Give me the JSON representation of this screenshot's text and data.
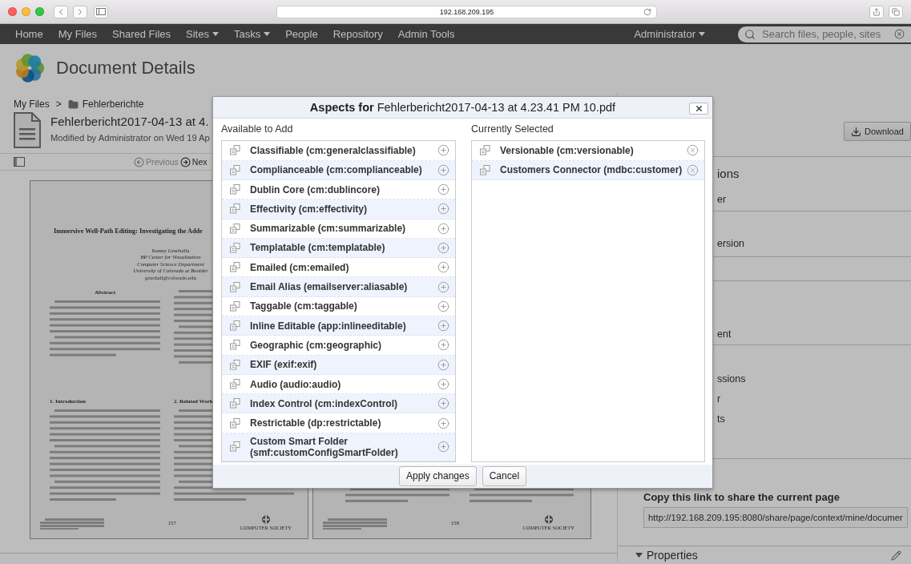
{
  "browser": {
    "address": "192.168.209.195"
  },
  "nav": {
    "items": [
      {
        "label": "Home",
        "dropdown": false
      },
      {
        "label": "My Files",
        "dropdown": false
      },
      {
        "label": "Shared Files",
        "dropdown": false
      },
      {
        "label": "Sites",
        "dropdown": true
      },
      {
        "label": "Tasks",
        "dropdown": true
      },
      {
        "label": "People",
        "dropdown": false
      },
      {
        "label": "Repository",
        "dropdown": false
      },
      {
        "label": "Admin Tools",
        "dropdown": false
      }
    ],
    "user": {
      "label": "Administrator",
      "dropdown": true
    },
    "search": {
      "placeholder": "Search files, people, sites"
    }
  },
  "header": {
    "title": "Document Details"
  },
  "breadcrumb": {
    "root": "My Files",
    "separator": ">",
    "folder": "Fehlerberichte"
  },
  "document": {
    "title": "Fehlerbericht2017-04-13 at 4.",
    "modified": "Modified by Administrator on Wed 19 Ap"
  },
  "viewer": {
    "previous": "Previous",
    "next": "Nex",
    "pages": [
      {
        "kind": "first",
        "title": "Immersive Well-Path Editing: Investigating the Adde",
        "authors": [
          {
            "text": "Kenny Gruchalla",
            "italic": false
          },
          {
            "text": "BP Center for Visualization",
            "italic": true
          },
          {
            "text": "Computer Science Department",
            "italic": true
          },
          {
            "text": "University of Colorado at Boulder",
            "italic": true
          },
          {
            "text": "gruchall@colorado.edu",
            "italic": false
          }
        ],
        "abstract_heading": "Abstract",
        "intro_heading": "1. Introduction",
        "related_heading": "2. Related Work",
        "page_number": "157",
        "logo_text": "COMPUTER SOCIETY"
      },
      {
        "kind": "continued",
        "page_number": "158",
        "logo_text": "COMPUTER SOCIETY"
      }
    ]
  },
  "side_panel": {
    "download": "Download",
    "sections": [
      {
        "heading": "ions",
        "items": [
          "er"
        ]
      },
      {
        "items": [
          "ersion"
        ]
      },
      {
        "items": [
          "ent"
        ]
      },
      {
        "items": [
          "ssions",
          "r",
          "ts"
        ]
      }
    ],
    "share": {
      "heading": "Copy this link to share the current page",
      "url": "http://192.168.209.195:8080/share/page/context/mine/documer"
    },
    "properties": {
      "label": "Properties"
    }
  },
  "dialog": {
    "title": "**Aspects for** Fehlerbericht2017-04-13 at 4.23.41 PM 10.pdf",
    "available": {
      "heading": "Available to Add",
      "items": [
        "Classifiable (cm:generalclassifiable)",
        "Complianceable (cm:complianceable)",
        "Dublin Core (cm:dublincore)",
        "Effectivity (cm:effectivity)",
        "Summarizable (cm:summarizable)",
        "Templatable (cm:templatable)",
        "Emailed (cm:emailed)",
        "Email Alias (emailserver:aliasable)",
        "Taggable (cm:taggable)",
        "Inline Editable (app:inlineeditable)",
        "Geographic (cm:geographic)",
        "EXIF (exif:exif)",
        "Audio (audio:audio)",
        "Index Control (cm:indexControl)",
        "Restrictable (dp:restrictable)",
        "Custom Smart Folder (smf:customConfigSmartFolder)"
      ]
    },
    "selected": {
      "heading": "Currently Selected",
      "items": [
        "Versionable (cm:versionable)",
        "Customers Connector (mdbc:customer)"
      ]
    },
    "buttons": [
      {
        "label": "Apply changes"
      },
      {
        "label": "Cancel"
      }
    ]
  }
}
